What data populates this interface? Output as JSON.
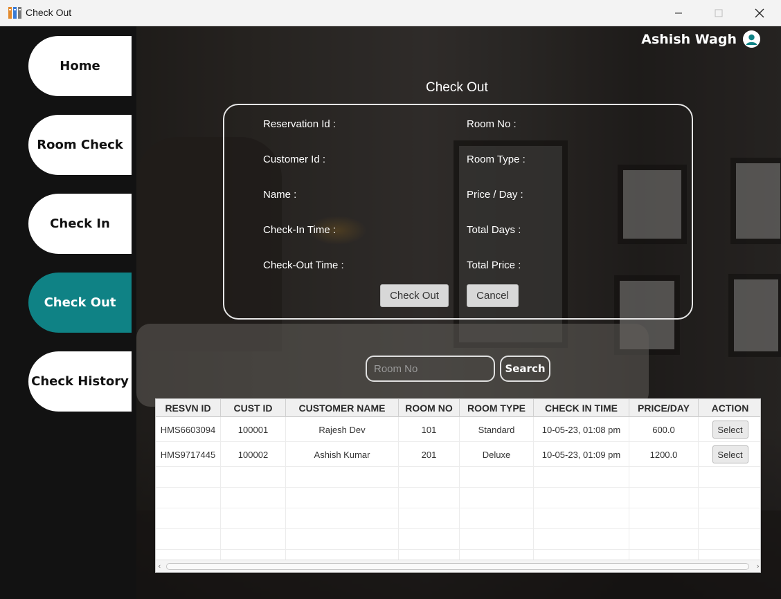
{
  "window": {
    "title": "Check Out"
  },
  "sidebar": {
    "items": [
      {
        "label": "Home",
        "active": false
      },
      {
        "label": "Room Check",
        "active": false
      },
      {
        "label": "Check In",
        "active": false
      },
      {
        "label": "Check Out",
        "active": true
      },
      {
        "label": "Check History",
        "active": false
      }
    ]
  },
  "header": {
    "user_name": "Ashish Wagh"
  },
  "form": {
    "title": "Check Out",
    "labels": {
      "reservation_id": "Reservation Id :",
      "customer_id": "Customer Id :",
      "name": "Name :",
      "check_in_time": "Check-In Time :",
      "check_out_time": "Check-Out Time :",
      "room_no": "Room No :",
      "room_type": "Room Type :",
      "price_day": "Price / Day :",
      "total_days": "Total Days :",
      "total_price": "Total Price :"
    },
    "checkout_button": "Check Out",
    "cancel_button": "Cancel"
  },
  "search": {
    "placeholder": "Room No",
    "value": "",
    "button": "Search"
  },
  "table": {
    "columns": [
      "RESVN ID",
      "CUST ID",
      "CUSTOMER NAME",
      "ROOM NO",
      "ROOM TYPE",
      "CHECK IN TIME",
      "PRICE/DAY",
      "ACTION"
    ],
    "rows": [
      {
        "resvn_id": "HMS6603094",
        "cust_id": "100001",
        "customer_name": "Rajesh Dev",
        "room_no": "101",
        "room_type": "Standard",
        "check_in_time": "10-05-23, 01:08 pm",
        "price_day": "600.0",
        "action": "Select"
      },
      {
        "resvn_id": "HMS9717445",
        "cust_id": "100002",
        "customer_name": "Ashish Kumar",
        "room_no": "201",
        "room_type": "Deluxe",
        "check_in_time": "10-05-23, 01:09 pm",
        "price_day": "1200.0",
        "action": "Select"
      }
    ]
  },
  "colors": {
    "sidebar_bg": "#121212",
    "active_nav": "#0f8285",
    "nav_bg": "#ffffff",
    "avatar": "#0f8285"
  }
}
